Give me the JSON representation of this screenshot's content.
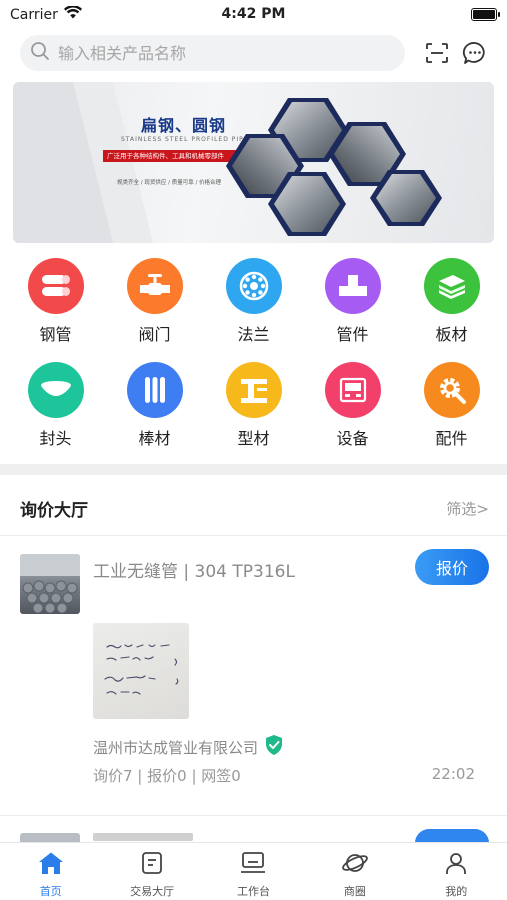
{
  "status_bar": {
    "carrier": "Carrier",
    "time": "4:42 PM"
  },
  "search": {
    "placeholder": "输入相关产品名称"
  },
  "banner": {
    "title": "扁钢、圆钢",
    "subtitle": "STAINLESS STEEL PROFILED PIPE",
    "tagline": "广泛用于各种结构件、工具和机械零部件",
    "small_text": "规类齐全 / 现货供应 / 质量可靠 / 价格合理"
  },
  "categories": [
    {
      "label": "钢管",
      "icon": "steel-pipe-icon",
      "color": "#f24a4a"
    },
    {
      "label": "阀门",
      "icon": "valve-icon",
      "color": "#fb7a2c"
    },
    {
      "label": "法兰",
      "icon": "flange-icon",
      "color": "#2ea7f0"
    },
    {
      "label": "管件",
      "icon": "pipe-fitting-icon",
      "color": "#a65cf2"
    },
    {
      "label": "板材",
      "icon": "plate-icon",
      "color": "#3cc23c"
    },
    {
      "label": "封头",
      "icon": "head-cap-icon",
      "color": "#1ec49a"
    },
    {
      "label": "棒材",
      "icon": "bar-stock-icon",
      "color": "#3f7ef2"
    },
    {
      "label": "型材",
      "icon": "profile-icon",
      "color": "#f7b81c"
    },
    {
      "label": "设备",
      "icon": "equipment-icon",
      "color": "#f2406a"
    },
    {
      "label": "配件",
      "icon": "accessory-gear-icon",
      "color": "#f78a1e"
    }
  ],
  "section": {
    "title": "询价大厅",
    "filter": "筛选>"
  },
  "inquiry": {
    "title": "工业无缝管 | 304 TP316L",
    "quote_button": "报价",
    "company": "温州市达成管业有限公司",
    "stats": "询价7 | 报价0 | 网签0",
    "time": "22:02"
  },
  "tabs": [
    {
      "label": "首页",
      "icon": "home-icon",
      "active": true
    },
    {
      "label": "交易大厅",
      "icon": "trading-hall-icon",
      "active": false
    },
    {
      "label": "工作台",
      "icon": "workbench-icon",
      "active": false
    },
    {
      "label": "商圈",
      "icon": "planet-icon",
      "active": false
    },
    {
      "label": "我的",
      "icon": "profile-icon",
      "active": false
    }
  ],
  "colors": {
    "accent": "#2b7de9",
    "verified": "#1fb98a"
  }
}
